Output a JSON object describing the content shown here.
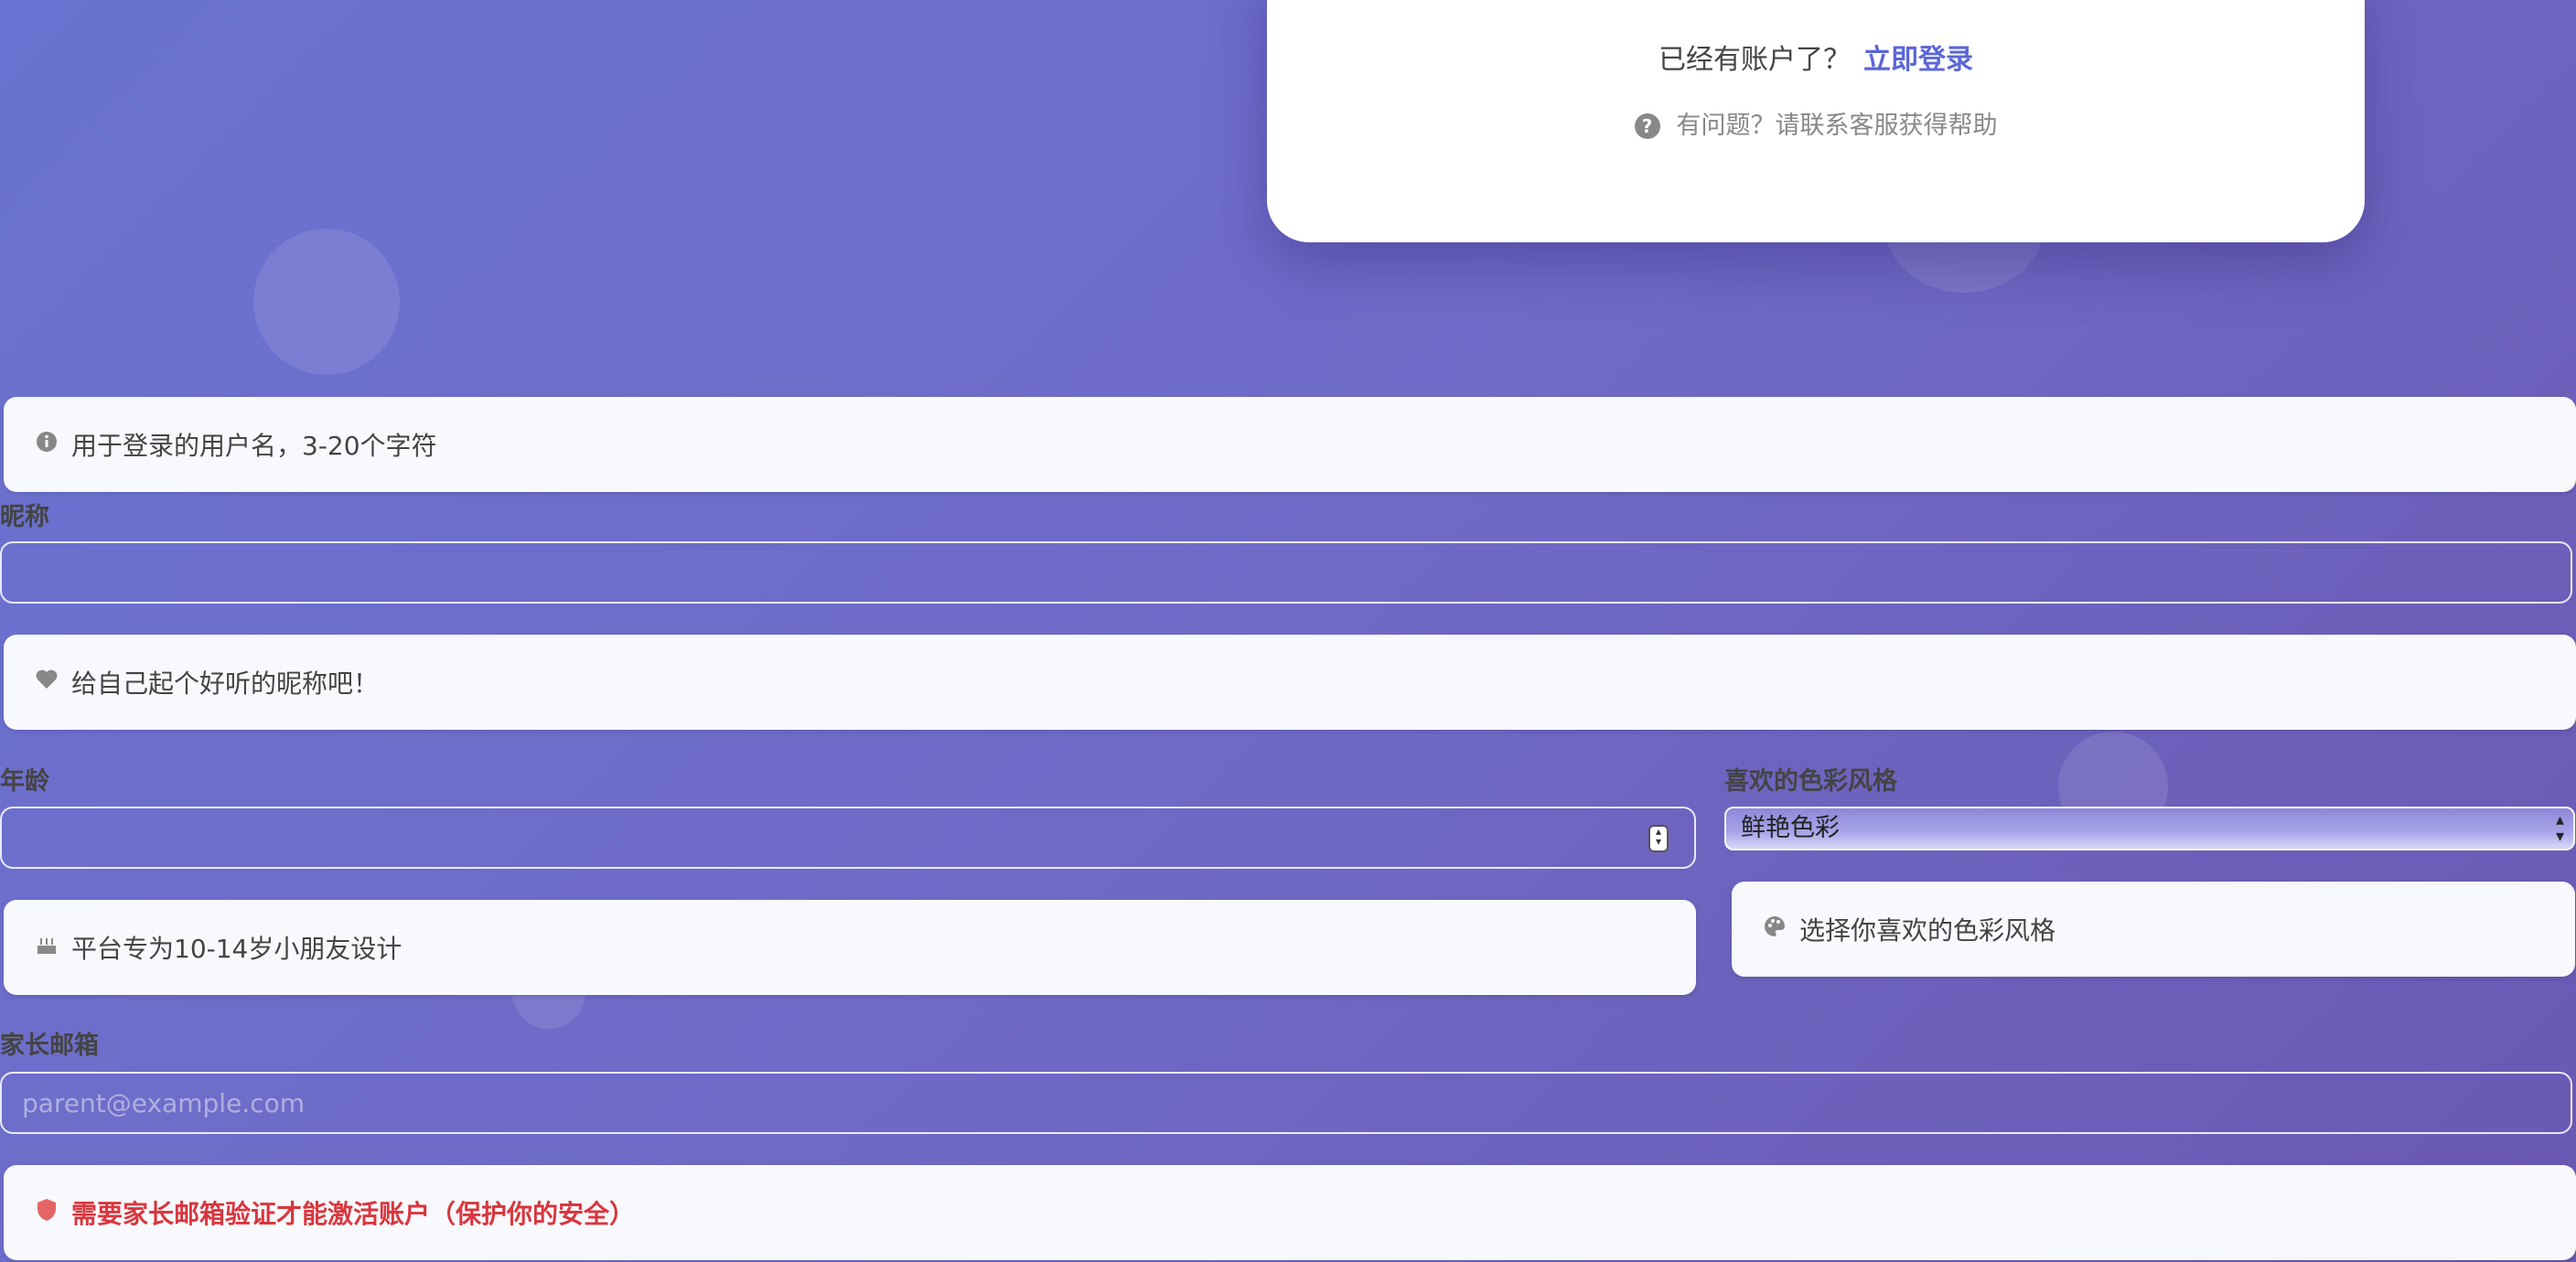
{
  "card": {
    "login_prompt": "已经有账户了？",
    "login_link": "立即登录",
    "help_text": "有问题？请联系客服获得帮助",
    "help_icon": "question-circle-icon"
  },
  "username": {
    "hint": "用于登录的用户名，3-20个字符",
    "hint_icon": "info-circle-icon"
  },
  "nickname": {
    "label": "昵称",
    "value": "",
    "hint": "给自己起个好听的昵称吧！",
    "hint_icon": "heart-icon"
  },
  "age": {
    "label": "年龄",
    "value": "",
    "hint": "平台专为10-14岁小朋友设计",
    "hint_icon": "birthday-cake-icon"
  },
  "color_style": {
    "label": "喜欢的色彩风格",
    "selected": "鲜艳色彩",
    "hint": "选择你喜欢的色彩风格",
    "hint_icon": "palette-icon"
  },
  "parent_email": {
    "label": "家长邮箱",
    "value": "",
    "placeholder": "parent@example.com",
    "hint": "需要家长邮箱验证才能激活账户（保护你的安全）",
    "hint_icon": "shield-icon"
  },
  "colors": {
    "accent": "#5b67d6",
    "warning": "#d9363e",
    "background_start": "#6a73d1",
    "background_end": "#6a58b2"
  }
}
